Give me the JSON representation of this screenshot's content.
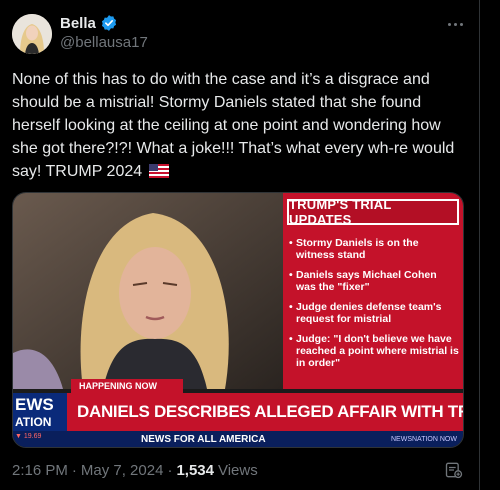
{
  "author": {
    "display_name": "Bella",
    "handle": "@bellausa17",
    "verified": true,
    "verified_color": "#1d9bf0"
  },
  "post": {
    "text": "None of this has to do with the case and it’s a disgrace and should be a mistrial! Stormy Daniels stated that she found herself looking at the ceiling at one point and wondering how she got there?!?! What a joke!!! That’s what every wh-re would say! TRUMP 2024",
    "emoji": "us-flag"
  },
  "media": {
    "panel_title": "TRUMP'S TRIAL UPDATES",
    "bullets": [
      "Stormy Daniels is on the witness stand",
      "Daniels says Michael Cohen was the \"fixer\"",
      "Judge denies defense team's request for mistrial",
      "Judge: \"I don't believe we have reached a point where mistrial is in order\""
    ],
    "banner_label": "HAPPENING NOW",
    "brand_top": "EWS",
    "brand_bottom": "ATION",
    "headline": "DANIELS DESCRIBES ALLEGED AFFAIR WITH TRUMP",
    "ticker_left": "▼ 19.69",
    "ticker_text": "NEWS FOR ALL AMERICA",
    "ticker_site": "NEWSNATION NOW"
  },
  "meta": {
    "time": "2:16 PM",
    "separator": "·",
    "date": "May 7, 2024",
    "views_count": "1,534",
    "views_label": "Views"
  },
  "colors": {
    "background": "#000000",
    "text": "#e7e9ea",
    "muted": "#71767b",
    "accent": "#1d9bf0"
  }
}
